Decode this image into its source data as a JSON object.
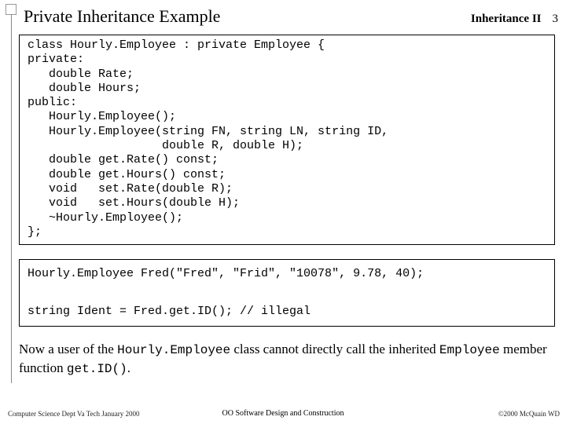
{
  "header": {
    "title": "Private Inheritance Example",
    "section": "Inheritance II",
    "page": "3"
  },
  "code": {
    "body": "class Hourly.Employee : private Employee {\nprivate:\n   double Rate;\n   double Hours;\npublic:\n   Hourly.Employee();\n   Hourly.Employee(string FN, string LN, string ID,\n                   double R, double H);\n   double get.Rate() const;\n   double get.Hours() const;\n   void   set.Rate(double R);\n   void   set.Hours(double H);\n   ~Hourly.Employee();\n};"
  },
  "usage": {
    "body": "Hourly.Employee Fred(\"Fred\", \"Frid\", \"10078\", 9.78, 40);\n\nstring Ident = Fred.get.ID(); // illegal"
  },
  "explain": {
    "t1": "Now a user of the ",
    "c1": "Hourly.Employee",
    "t2": " class cannot directly call the inherited ",
    "c2": "Employee",
    "t3": " member function ",
    "c3": "get.ID()",
    "t4": "."
  },
  "footer": {
    "left": "Computer Science Dept Va Tech January 2000",
    "center": "OO Software Design and Construction",
    "right": "©2000 McQuain WD"
  }
}
